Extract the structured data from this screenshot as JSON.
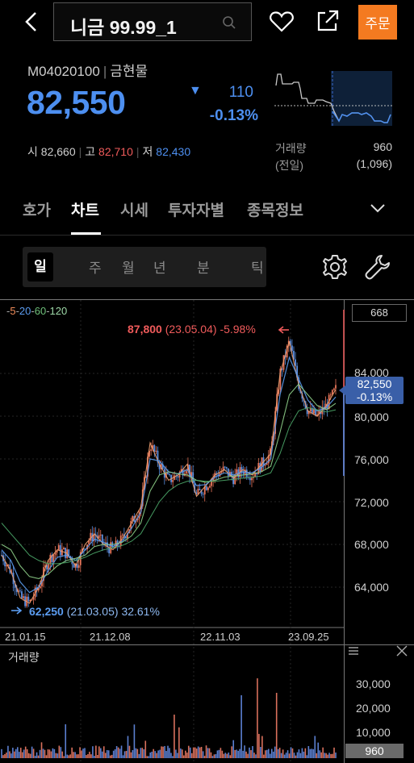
{
  "header": {
    "stock_name": "니금 99.99_1",
    "order_label": "주문"
  },
  "quote": {
    "code": "M04020100",
    "market": "금현물",
    "price": "82,550",
    "change_arrow": "▼",
    "change": "110",
    "change_pct": "-0.13%",
    "open_label": "시",
    "open": "82,660",
    "high_label": "고",
    "high": "82,710",
    "low_label": "저",
    "low": "82,430",
    "volume_label": "거래량",
    "volume": "960",
    "prev_label": "(전일)",
    "prev_volume": "(1,096)"
  },
  "tabs": [
    {
      "label": "호가"
    },
    {
      "label": "차트"
    },
    {
      "label": "시세"
    },
    {
      "label": "투자자별"
    },
    {
      "label": "종목정보"
    }
  ],
  "period_options": [
    {
      "label": "일"
    },
    {
      "label": "주"
    },
    {
      "label": "월"
    },
    {
      "label": "년"
    },
    {
      "label": "분"
    },
    {
      "label": "틱"
    }
  ],
  "chart": {
    "ma_legend": [
      "5",
      "20",
      "60",
      "120"
    ],
    "indicator_value": "668",
    "max_price": "87,800",
    "max_date": "(23.05.04)",
    "max_pct": "-5.98%",
    "min_price": "62,250",
    "min_date": "(21.03.05)",
    "min_pct": "32.61%",
    "current_price": "82,550",
    "current_pct": "-0.13%",
    "y_labels": [
      "84,000",
      "80,000",
      "76,000",
      "72,000",
      "68,000",
      "64,000"
    ],
    "x_labels": [
      "21.01.15",
      "21.12.08",
      "22.11.03",
      "23.09.25"
    ],
    "volume_title": "거래량",
    "volume_y_labels": [
      "30,000",
      "20,000",
      "10,000"
    ],
    "volume_current": "960"
  },
  "colors": {
    "accent_orange": "#f47a20",
    "down_blue": "#4d8ff0",
    "up_red": "#f05b5b"
  },
  "chart_data": {
    "type": "line",
    "x_labels": [
      "21.01.15",
      "21.12.08",
      "22.11.03",
      "23.09.25"
    ],
    "ylim": [
      62000,
      89000
    ],
    "series": [
      {
        "name": "5",
        "values": [
          67000,
          65500,
          63000,
          62500,
          64000,
          66500,
          67500,
          67200,
          66000,
          68000,
          69000,
          68000,
          67500,
          68500,
          70000,
          71500,
          77500,
          75500,
          74000,
          74500,
          75500,
          72500,
          73500,
          74500,
          75000,
          74200,
          75000,
          74500,
          75500,
          76500,
          84000,
          87000,
          83000,
          80500,
          80000,
          81000,
          82500
        ]
      },
      {
        "name": "20",
        "values": [
          67500,
          66500,
          64500,
          63500,
          64000,
          65500,
          66800,
          67000,
          66500,
          67500,
          68500,
          68200,
          67800,
          68300,
          69500,
          71000,
          76000,
          75800,
          74800,
          74600,
          75000,
          73500,
          73600,
          74300,
          74700,
          74500,
          74800,
          74700,
          75200,
          76000,
          82000,
          85500,
          83500,
          81500,
          80500,
          80800,
          81800
        ]
      },
      {
        "name": "60",
        "values": [
          68000,
          67500,
          66000,
          65000,
          64800,
          65200,
          66000,
          66500,
          66700,
          67000,
          67800,
          68000,
          68000,
          68200,
          68800,
          70000,
          73000,
          74500,
          74800,
          74600,
          74500,
          74000,
          73800,
          74000,
          74300,
          74400,
          74500,
          74600,
          74800,
          75300,
          78500,
          82000,
          83000,
          82000,
          81000,
          80600,
          81200
        ]
      },
      {
        "name": "120",
        "values": [
          70000,
          69000,
          68000,
          67000,
          66500,
          66200,
          66200,
          66300,
          66500,
          66800,
          67200,
          67500,
          67700,
          67900,
          68300,
          69000,
          70500,
          72000,
          73000,
          73600,
          73900,
          74000,
          73900,
          73900,
          74000,
          74100,
          74200,
          74300,
          74400,
          74700,
          76500,
          79000,
          80500,
          80800,
          80600,
          80400,
          80600
        ]
      }
    ],
    "annotations": [
      {
        "label": "87,800 (23.05.04) -5.98%",
        "value": 87800
      },
      {
        "label": "62,250 (21.03.05) 32.61%",
        "value": 62250
      }
    ],
    "current": 82550,
    "volume": {
      "ylim": [
        0,
        35000
      ],
      "y_ticks": [
        10000,
        20000,
        30000
      ],
      "current": 960
    }
  }
}
